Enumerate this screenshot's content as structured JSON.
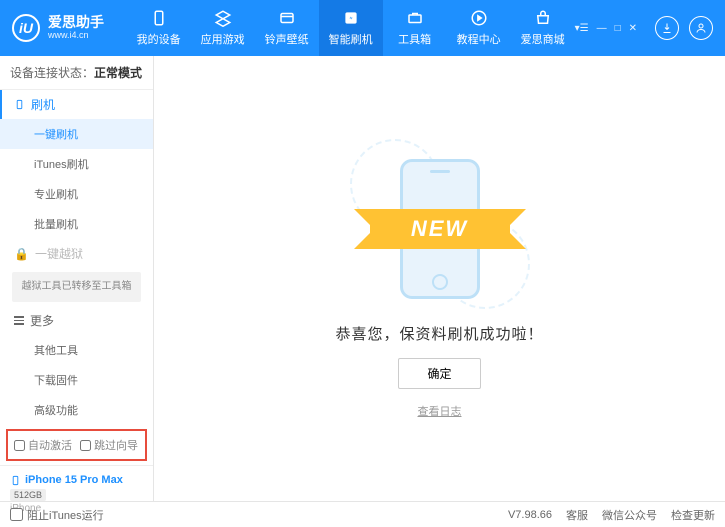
{
  "brand": {
    "title": "爱思助手",
    "url": "www.i4.cn",
    "logo_letter": "iU"
  },
  "nav": [
    {
      "label": "我的设备",
      "icon": "device"
    },
    {
      "label": "应用游戏",
      "icon": "apps"
    },
    {
      "label": "铃声壁纸",
      "icon": "ringtone"
    },
    {
      "label": "智能刷机",
      "icon": "flash",
      "active": true
    },
    {
      "label": "工具箱",
      "icon": "toolbox"
    },
    {
      "label": "教程中心",
      "icon": "tutorial"
    },
    {
      "label": "爱思商城",
      "icon": "store"
    }
  ],
  "status": {
    "label": "设备连接状态：",
    "value": "正常模式"
  },
  "sidebar": {
    "flash_header": "刷机",
    "flash_items": [
      "一键刷机",
      "iTunes刷机",
      "专业刷机",
      "批量刷机"
    ],
    "jailbreak_header": "一键越狱",
    "jailbreak_note": "越狱工具已转移至工具箱",
    "more_header": "更多",
    "more_items": [
      "其他工具",
      "下载固件",
      "高级功能"
    ],
    "checkbox1": "自动激活",
    "checkbox2": "跳过向导"
  },
  "device": {
    "name": "iPhone 15 Pro Max",
    "storage": "512GB",
    "type": "iPhone"
  },
  "main": {
    "ribbon": "NEW",
    "success": "恭喜您，保资料刷机成功啦！",
    "ok": "确定",
    "view_log": "查看日志"
  },
  "footer": {
    "block_itunes": "阻止iTunes运行",
    "version": "V7.98.66",
    "links": [
      "客服",
      "微信公众号",
      "检查更新"
    ]
  }
}
